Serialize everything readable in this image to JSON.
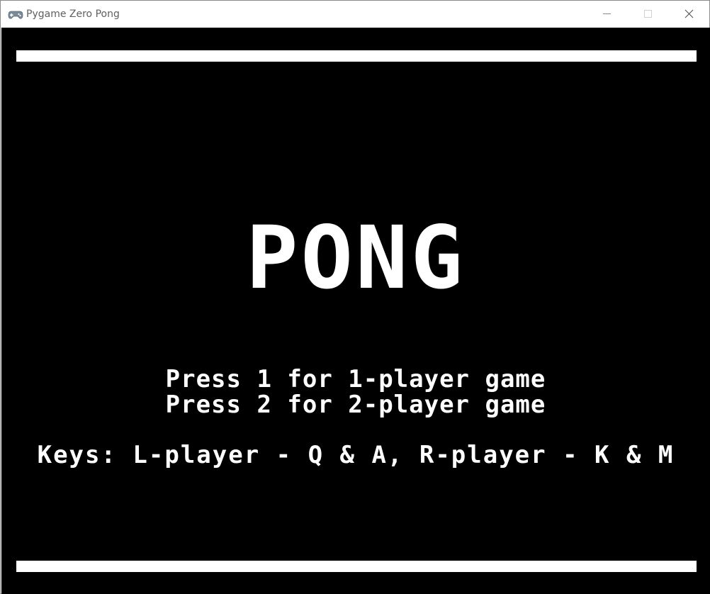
{
  "window": {
    "title": "Pygame Zero Pong",
    "icon": "gamepad-icon"
  },
  "controls": {
    "minimize_icon": "minimize-icon",
    "maximize_icon": "maximize-icon",
    "close_icon": "close-icon"
  },
  "game": {
    "title": "PONG",
    "line1": "Press 1 for 1-player game",
    "line2": "Press 2 for 2-player game",
    "keys": "Keys: L-player - Q & A, R-player - K & M",
    "colors": {
      "background": "#000000",
      "foreground": "#ffffff"
    }
  }
}
